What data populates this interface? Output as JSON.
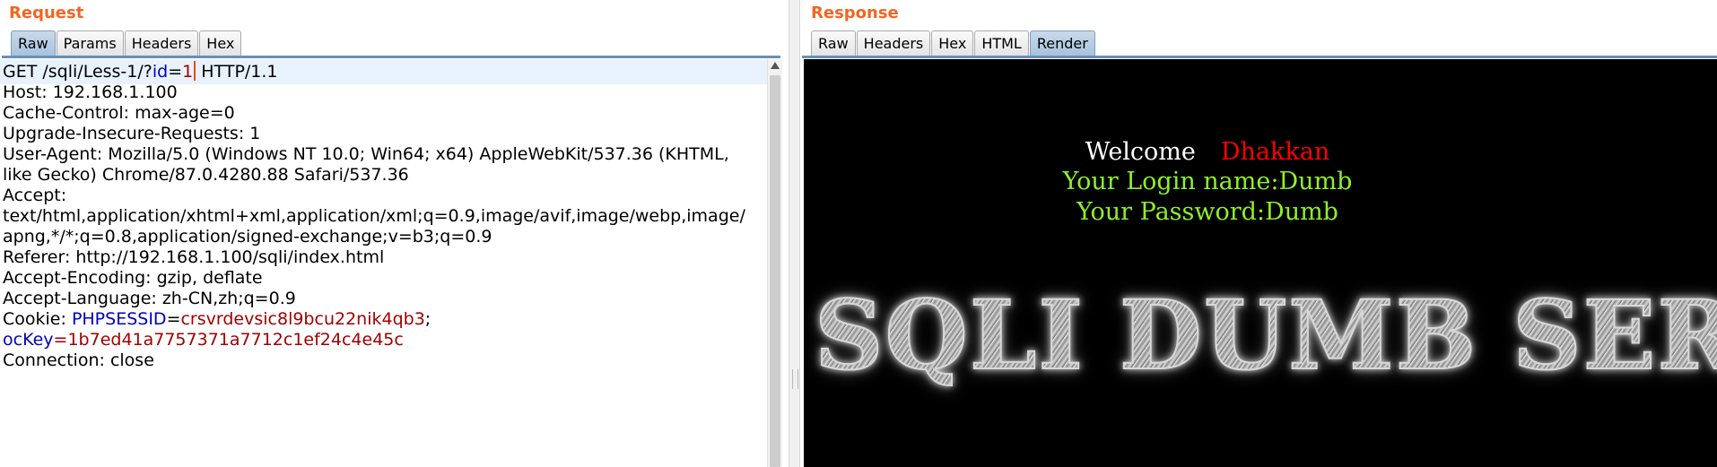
{
  "request": {
    "title": "Request",
    "tabs": [
      "Raw",
      "Params",
      "Headers",
      "Hex"
    ],
    "active_tab": "Raw",
    "lines": {
      "l1_prefix": "GET /sqli/Less-1/?",
      "l1_key": "id",
      "l1_eq": "=",
      "l1_val": "1",
      "l1_suffix": " HTTP/1.1",
      "host": "Host: 192.168.1.100",
      "cache": "Cache-Control: max-age=0",
      "upgrade": "Upgrade-Insecure-Requests: 1",
      "ua1": "User-Agent: Mozilla/5.0 (Windows NT 10.0; Win64; x64) AppleWebKit/537.36 (KHTML,",
      "ua2": "like Gecko) Chrome/87.0.4280.88 Safari/537.36",
      "accept_label": "Accept:",
      "accept1": "text/html,application/xhtml+xml,application/xml;q=0.9,image/avif,image/webp,image/",
      "accept2": "apng,*/*;q=0.8,application/signed-exchange;v=b3;q=0.9",
      "referer": "Referer: http://192.168.1.100/sqli/index.html",
      "encoding": "Accept-Encoding: gzip, deflate",
      "language": "Accept-Language: zh-CN,zh;q=0.9",
      "cookie_label": "Cookie: ",
      "cookie_key1": "PHPSESSID",
      "cookie_eq1": "=",
      "cookie_val1": "crsvrdevsic8l9bcu22nik4qb3",
      "cookie_sep": ";",
      "cookie_key2": "ocKey",
      "cookie_eq2": "=",
      "cookie_val2": "1b7ed41a7757371a7712c1ef24c4e45c",
      "connection": "Connection: close"
    }
  },
  "response": {
    "title": "Response",
    "tabs": [
      "Raw",
      "Headers",
      "Hex",
      "HTML",
      "Render"
    ],
    "active_tab": "Render",
    "render": {
      "welcome": "Welcome",
      "name": "Dhakkan",
      "login": "Your Login name:Dumb",
      "password": "Your Password:Dumb",
      "banner": "SQLI DUMB SERIES"
    }
  },
  "colors": {
    "title_orange": "#f26522",
    "param_key_blue": "#0000c0",
    "param_val_red": "#a00000",
    "render_green": "#8ff02a",
    "render_red": "#ff0000"
  }
}
